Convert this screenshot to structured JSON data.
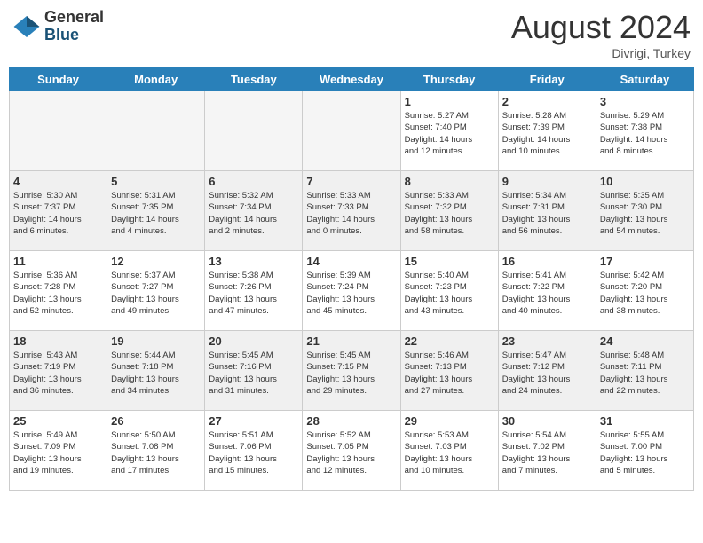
{
  "header": {
    "logo_general": "General",
    "logo_blue": "Blue",
    "month_title": "August 2024",
    "location": "Divrigi, Turkey"
  },
  "weekdays": [
    "Sunday",
    "Monday",
    "Tuesday",
    "Wednesday",
    "Thursday",
    "Friday",
    "Saturday"
  ],
  "weeks": [
    [
      {
        "day": "",
        "info": ""
      },
      {
        "day": "",
        "info": ""
      },
      {
        "day": "",
        "info": ""
      },
      {
        "day": "",
        "info": ""
      },
      {
        "day": "1",
        "info": "Sunrise: 5:27 AM\nSunset: 7:40 PM\nDaylight: 14 hours\nand 12 minutes."
      },
      {
        "day": "2",
        "info": "Sunrise: 5:28 AM\nSunset: 7:39 PM\nDaylight: 14 hours\nand 10 minutes."
      },
      {
        "day": "3",
        "info": "Sunrise: 5:29 AM\nSunset: 7:38 PM\nDaylight: 14 hours\nand 8 minutes."
      }
    ],
    [
      {
        "day": "4",
        "info": "Sunrise: 5:30 AM\nSunset: 7:37 PM\nDaylight: 14 hours\nand 6 minutes."
      },
      {
        "day": "5",
        "info": "Sunrise: 5:31 AM\nSunset: 7:35 PM\nDaylight: 14 hours\nand 4 minutes."
      },
      {
        "day": "6",
        "info": "Sunrise: 5:32 AM\nSunset: 7:34 PM\nDaylight: 14 hours\nand 2 minutes."
      },
      {
        "day": "7",
        "info": "Sunrise: 5:33 AM\nSunset: 7:33 PM\nDaylight: 14 hours\nand 0 minutes."
      },
      {
        "day": "8",
        "info": "Sunrise: 5:33 AM\nSunset: 7:32 PM\nDaylight: 13 hours\nand 58 minutes."
      },
      {
        "day": "9",
        "info": "Sunrise: 5:34 AM\nSunset: 7:31 PM\nDaylight: 13 hours\nand 56 minutes."
      },
      {
        "day": "10",
        "info": "Sunrise: 5:35 AM\nSunset: 7:30 PM\nDaylight: 13 hours\nand 54 minutes."
      }
    ],
    [
      {
        "day": "11",
        "info": "Sunrise: 5:36 AM\nSunset: 7:28 PM\nDaylight: 13 hours\nand 52 minutes."
      },
      {
        "day": "12",
        "info": "Sunrise: 5:37 AM\nSunset: 7:27 PM\nDaylight: 13 hours\nand 49 minutes."
      },
      {
        "day": "13",
        "info": "Sunrise: 5:38 AM\nSunset: 7:26 PM\nDaylight: 13 hours\nand 47 minutes."
      },
      {
        "day": "14",
        "info": "Sunrise: 5:39 AM\nSunset: 7:24 PM\nDaylight: 13 hours\nand 45 minutes."
      },
      {
        "day": "15",
        "info": "Sunrise: 5:40 AM\nSunset: 7:23 PM\nDaylight: 13 hours\nand 43 minutes."
      },
      {
        "day": "16",
        "info": "Sunrise: 5:41 AM\nSunset: 7:22 PM\nDaylight: 13 hours\nand 40 minutes."
      },
      {
        "day": "17",
        "info": "Sunrise: 5:42 AM\nSunset: 7:20 PM\nDaylight: 13 hours\nand 38 minutes."
      }
    ],
    [
      {
        "day": "18",
        "info": "Sunrise: 5:43 AM\nSunset: 7:19 PM\nDaylight: 13 hours\nand 36 minutes."
      },
      {
        "day": "19",
        "info": "Sunrise: 5:44 AM\nSunset: 7:18 PM\nDaylight: 13 hours\nand 34 minutes."
      },
      {
        "day": "20",
        "info": "Sunrise: 5:45 AM\nSunset: 7:16 PM\nDaylight: 13 hours\nand 31 minutes."
      },
      {
        "day": "21",
        "info": "Sunrise: 5:45 AM\nSunset: 7:15 PM\nDaylight: 13 hours\nand 29 minutes."
      },
      {
        "day": "22",
        "info": "Sunrise: 5:46 AM\nSunset: 7:13 PM\nDaylight: 13 hours\nand 27 minutes."
      },
      {
        "day": "23",
        "info": "Sunrise: 5:47 AM\nSunset: 7:12 PM\nDaylight: 13 hours\nand 24 minutes."
      },
      {
        "day": "24",
        "info": "Sunrise: 5:48 AM\nSunset: 7:11 PM\nDaylight: 13 hours\nand 22 minutes."
      }
    ],
    [
      {
        "day": "25",
        "info": "Sunrise: 5:49 AM\nSunset: 7:09 PM\nDaylight: 13 hours\nand 19 minutes."
      },
      {
        "day": "26",
        "info": "Sunrise: 5:50 AM\nSunset: 7:08 PM\nDaylight: 13 hours\nand 17 minutes."
      },
      {
        "day": "27",
        "info": "Sunrise: 5:51 AM\nSunset: 7:06 PM\nDaylight: 13 hours\nand 15 minutes."
      },
      {
        "day": "28",
        "info": "Sunrise: 5:52 AM\nSunset: 7:05 PM\nDaylight: 13 hours\nand 12 minutes."
      },
      {
        "day": "29",
        "info": "Sunrise: 5:53 AM\nSunset: 7:03 PM\nDaylight: 13 hours\nand 10 minutes."
      },
      {
        "day": "30",
        "info": "Sunrise: 5:54 AM\nSunset: 7:02 PM\nDaylight: 13 hours\nand 7 minutes."
      },
      {
        "day": "31",
        "info": "Sunrise: 5:55 AM\nSunset: 7:00 PM\nDaylight: 13 hours\nand 5 minutes."
      }
    ]
  ]
}
